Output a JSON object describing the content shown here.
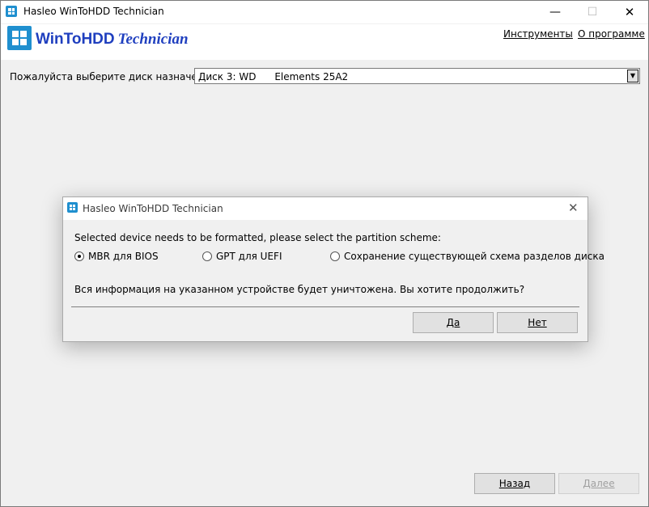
{
  "window": {
    "title": "Hasleo WinToHDD Technician",
    "minimize_glyph": "—",
    "maximize_glyph": "☐",
    "close_glyph": "✕"
  },
  "header": {
    "brand_main": "WinToHDD",
    "brand_sub": "Technician",
    "menu": {
      "tools": "Инструменты",
      "about": "О программе"
    }
  },
  "disk": {
    "label": "Пожалуйста выберите диск назначения:",
    "selected": "Диск 3: WD      Elements 25A2",
    "arrow_glyph": "▼"
  },
  "dialog": {
    "title": "Hasleo WinToHDD Technician",
    "close_glyph": "✕",
    "prompt": "Selected device needs to be formatted, please select the partition scheme:",
    "options": [
      {
        "label": "MBR для BIOS",
        "selected": true
      },
      {
        "label": "GPT для UEFI",
        "selected": false
      },
      {
        "label": "Сохранение существующей схема разделов диска",
        "selected": false
      }
    ],
    "warning": "Вся информация на указанном устройстве будет уничтожена. Вы хотите продолжить?",
    "yes_label": "Да",
    "no_label": "Нет"
  },
  "footer": {
    "back_label": "Назад",
    "next_label": "Далее"
  },
  "colors": {
    "accent": "#1f8fcf",
    "brand_text": "#1f3fbf",
    "background": "#f0f0f0"
  },
  "icons": {
    "app": "windows-logo-icon"
  }
}
